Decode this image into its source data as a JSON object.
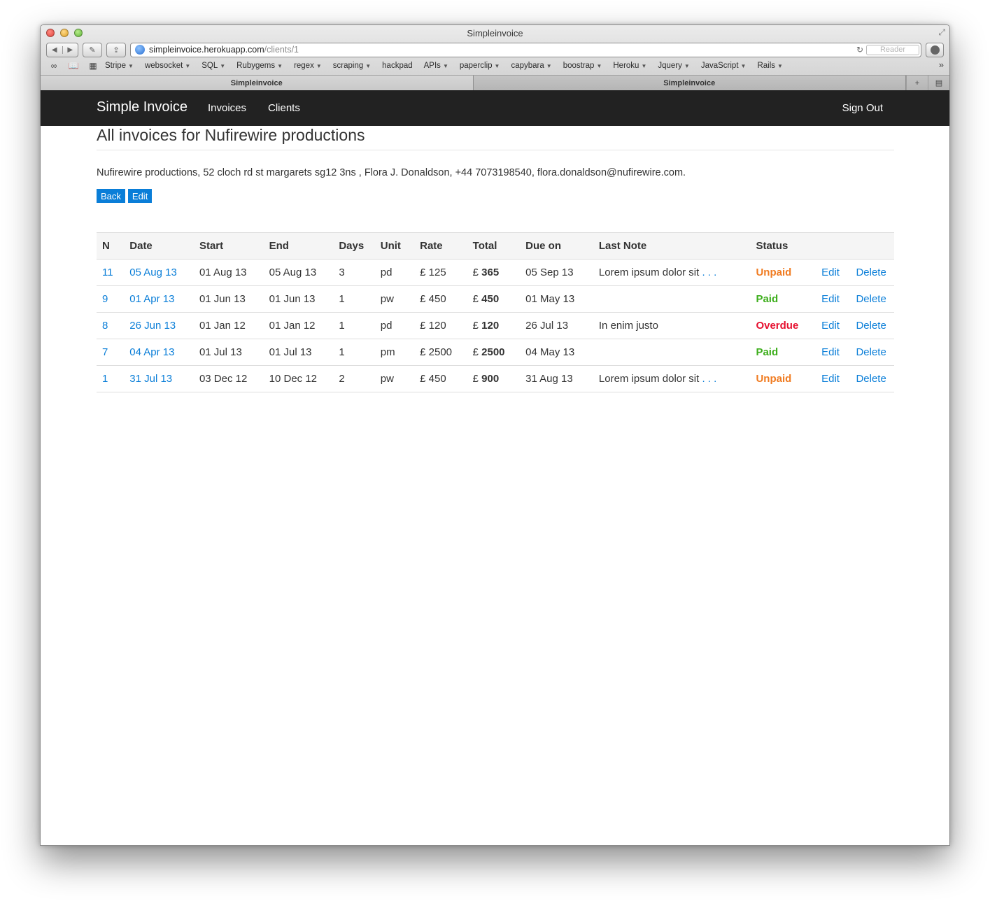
{
  "browser": {
    "window_title": "Simpleinvoice",
    "url_host": "simpleinvoice.herokuapp.com",
    "url_path": "/clients/1",
    "reader_label": "Reader",
    "bookmarks": [
      {
        "label": "Stripe",
        "menu": true
      },
      {
        "label": "websocket",
        "menu": true
      },
      {
        "label": "SQL",
        "menu": true
      },
      {
        "label": "Rubygems",
        "menu": true
      },
      {
        "label": "regex",
        "menu": true
      },
      {
        "label": "scraping",
        "menu": true
      },
      {
        "label": "hackpad",
        "menu": false
      },
      {
        "label": "APIs",
        "menu": true
      },
      {
        "label": "paperclip",
        "menu": true
      },
      {
        "label": "capybara",
        "menu": true
      },
      {
        "label": "boostrap",
        "menu": true
      },
      {
        "label": "Heroku",
        "menu": true
      },
      {
        "label": "Jquery",
        "menu": true
      },
      {
        "label": "JavaScript",
        "menu": true
      },
      {
        "label": "Rails",
        "menu": true
      }
    ],
    "tabs": [
      {
        "label": "Simpleinvoice",
        "active": true
      },
      {
        "label": "Simpleinvoice",
        "active": false
      }
    ]
  },
  "navbar": {
    "brand": "Simple Invoice",
    "links": [
      "Invoices",
      "Clients"
    ],
    "sign_out": "Sign Out"
  },
  "page": {
    "heading": "All invoices for Nufirewire productions",
    "client_info": "Nufirewire productions, 52 cloch rd st margarets sg12 3ns , Flora J. Donaldson, +44 7073198540, flora.donaldson@nufirewire.com.",
    "back_label": "Back",
    "edit_label": "Edit"
  },
  "table": {
    "headers": [
      "N",
      "Date",
      "Start",
      "End",
      "Days",
      "Unit",
      "Rate",
      "Total",
      "Due on",
      "Last Note",
      "Status",
      "",
      ""
    ],
    "rows": [
      {
        "n": "11",
        "date": "05 Aug 13",
        "start": "01 Aug 13",
        "end": "05 Aug 13",
        "days": "3",
        "unit": "pd",
        "rate": "£ 125",
        "total_prefix": "£ ",
        "total": "365",
        "due": "05 Sep 13",
        "note": "Lorem ipsum dolor sit",
        "note_more": ". . .",
        "status": "Unpaid",
        "status_class": "st-unpaid",
        "edit": "Edit",
        "delete": "Delete"
      },
      {
        "n": "9",
        "date": "01 Apr 13",
        "start": "01 Jun 13",
        "end": "01 Jun 13",
        "days": "1",
        "unit": "pw",
        "rate": "£ 450",
        "total_prefix": "£ ",
        "total": "450",
        "due": "01 May 13",
        "note": "",
        "note_more": "",
        "status": "Paid",
        "status_class": "st-paid",
        "edit": "Edit",
        "delete": "Delete"
      },
      {
        "n": "8",
        "date": "26 Jun 13",
        "start": "01 Jan 12",
        "end": "01 Jan 12",
        "days": "1",
        "unit": "pd",
        "rate": "£ 120",
        "total_prefix": "£ ",
        "total": "120",
        "due": "26 Jul 13",
        "note": "In enim justo",
        "note_more": "",
        "status": "Overdue",
        "status_class": "st-overdue",
        "edit": "Edit",
        "delete": "Delete"
      },
      {
        "n": "7",
        "date": "04 Apr 13",
        "start": "01 Jul 13",
        "end": "01 Jul 13",
        "days": "1",
        "unit": "pm",
        "rate": "£ 2500",
        "total_prefix": "£ ",
        "total": "2500",
        "due": "04 May 13",
        "note": "",
        "note_more": "",
        "status": "Paid",
        "status_class": "st-paid",
        "edit": "Edit",
        "delete": "Delete"
      },
      {
        "n": "1",
        "date": "31 Jul 13",
        "start": "03 Dec 12",
        "end": "10 Dec 12",
        "days": "2",
        "unit": "pw",
        "rate": "£ 450",
        "total_prefix": "£ ",
        "total": "900",
        "due": "31 Aug 13",
        "note": "Lorem ipsum dolor sit",
        "note_more": ". . .",
        "status": "Unpaid",
        "status_class": "st-unpaid",
        "edit": "Edit",
        "delete": "Delete"
      }
    ]
  },
  "colors": {
    "link": "#0a7ed8",
    "navbar": "#222222",
    "unpaid": "#f07b20",
    "paid": "#3dae1c",
    "overdue": "#e6102f"
  }
}
